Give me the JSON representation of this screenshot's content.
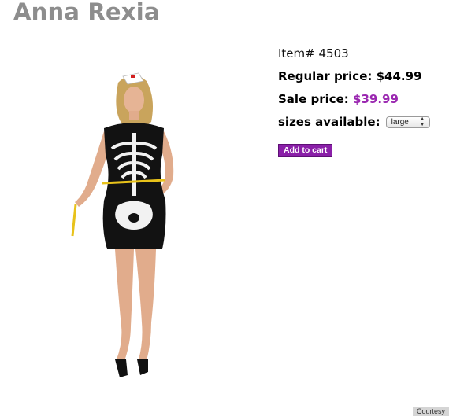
{
  "product": {
    "title": "Anna Rexia",
    "item_label": "Item#",
    "item_number": "4503",
    "regular_price_label": "Regular price:",
    "regular_price": "$44.99",
    "sale_price_label": "Sale price:",
    "sale_price": "$39.99",
    "sizes_label": "sizes available:",
    "selected_size": "large",
    "add_to_cart": "Add to cart"
  },
  "credit": "Courtesy",
  "colors": {
    "title": "#8d8d8d",
    "sale_price": "#9a27b0",
    "button": "#8a1fa8"
  },
  "icons": {
    "select_arrows": "up-down-arrows-icon"
  }
}
